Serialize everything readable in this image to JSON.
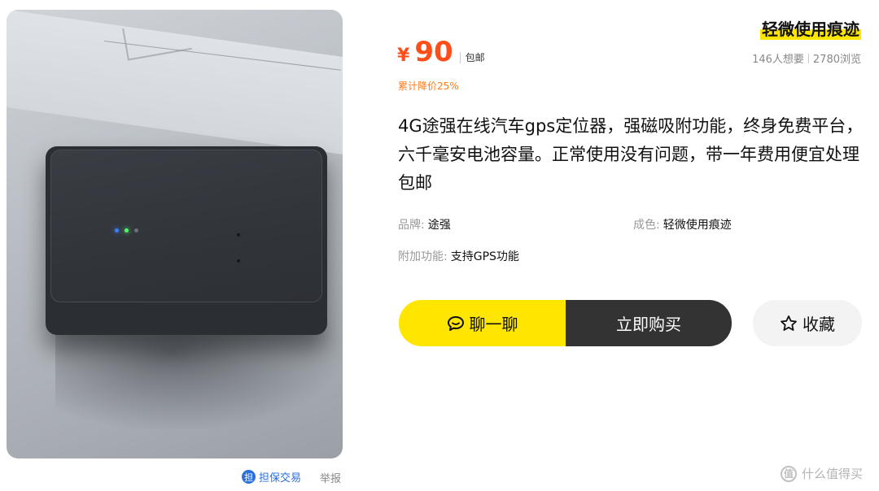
{
  "listing": {
    "currency": "¥",
    "price": "90",
    "shipping": "包邮",
    "price_drop": "累计降价25%",
    "condition_badge": "轻微使用痕迹",
    "stats": {
      "wants": "146人想要",
      "views": "2780浏览"
    },
    "title": "4G途强在线汽车gps定位器，强磁吸附功能，终身免费平台，六千毫安电池容量。正常使用没有问题，带一年费用便宜处理包邮",
    "attributes": {
      "brand_label": "品牌:",
      "brand_value": "途强",
      "condition_label": "成色:",
      "condition_value": "轻微使用痕迹",
      "extra_label": "附加功能:",
      "extra_value": "支持GPS功能"
    }
  },
  "actions": {
    "chat": "聊一聊",
    "buy": "立即购买",
    "favorite": "收藏"
  },
  "photo_footer": {
    "guarantee": "担保交易",
    "guarantee_icon": "担",
    "report": "举报"
  },
  "watermark": {
    "text": "什么值得买",
    "logo": "值"
  },
  "colors": {
    "price": "#ff4e1a",
    "accent_yellow": "#ffe600",
    "buy_button": "#333333",
    "link_blue": "#2a6fdb"
  }
}
